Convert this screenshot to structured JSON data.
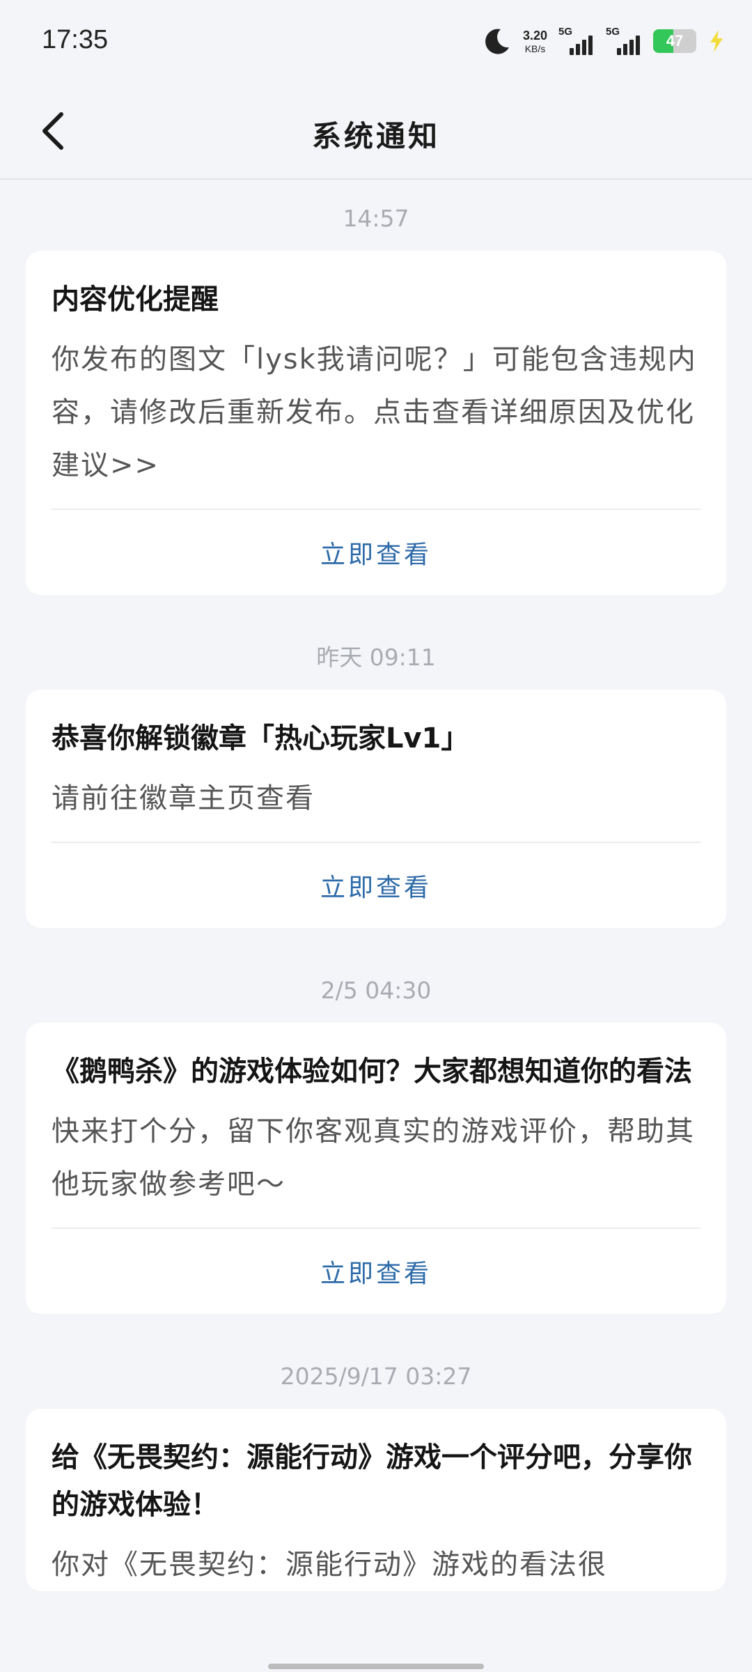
{
  "status_bar": {
    "time": "17:35",
    "net_speed_value": "3.20",
    "net_speed_unit": "KB/s",
    "sim1_label": "5G",
    "sim2_label": "5G",
    "battery_level": "47",
    "battery_fraction": 0.47,
    "icons": [
      "moon-icon",
      "signal-icon",
      "battery-icon",
      "charging-bolt-icon"
    ]
  },
  "header": {
    "title": "系统通知",
    "back_icon": "chevron-left-icon"
  },
  "notifications": [
    {
      "timestamp": "14:57",
      "title": "内容优化提醒",
      "body": "你发布的图文「lysk我请问呢？」可能包含违规内容，请修改后重新发布。点击查看详细原因及优化建议>>",
      "action": "立即查看"
    },
    {
      "timestamp": "昨天 09:11",
      "title": "恭喜你解锁徽章「热心玩家Lv1」",
      "body": "请前往徽章主页查看",
      "action": "立即查看"
    },
    {
      "timestamp": "2/5 04:30",
      "title": "《鹅鸭杀》的游戏体验如何？大家都想知道你的看法",
      "body": "快来打个分，留下你客观真实的游戏评价，帮助其他玩家做参考吧～",
      "action": "立即查看"
    },
    {
      "timestamp": "2025/9/17 03:27",
      "title": "给《无畏契约：源能行动》游戏一个评分吧，分享你的游戏体验！",
      "body": "你对《无畏契约：源能行动》游戏的看法很"
    }
  ],
  "colors": {
    "background": "#f4f5f8",
    "card": "#ffffff",
    "action_link": "#2d6aa8",
    "timestamp": "#a9abb2",
    "battery_fill": "#33c75a",
    "bolt": "#f2dc3a"
  }
}
